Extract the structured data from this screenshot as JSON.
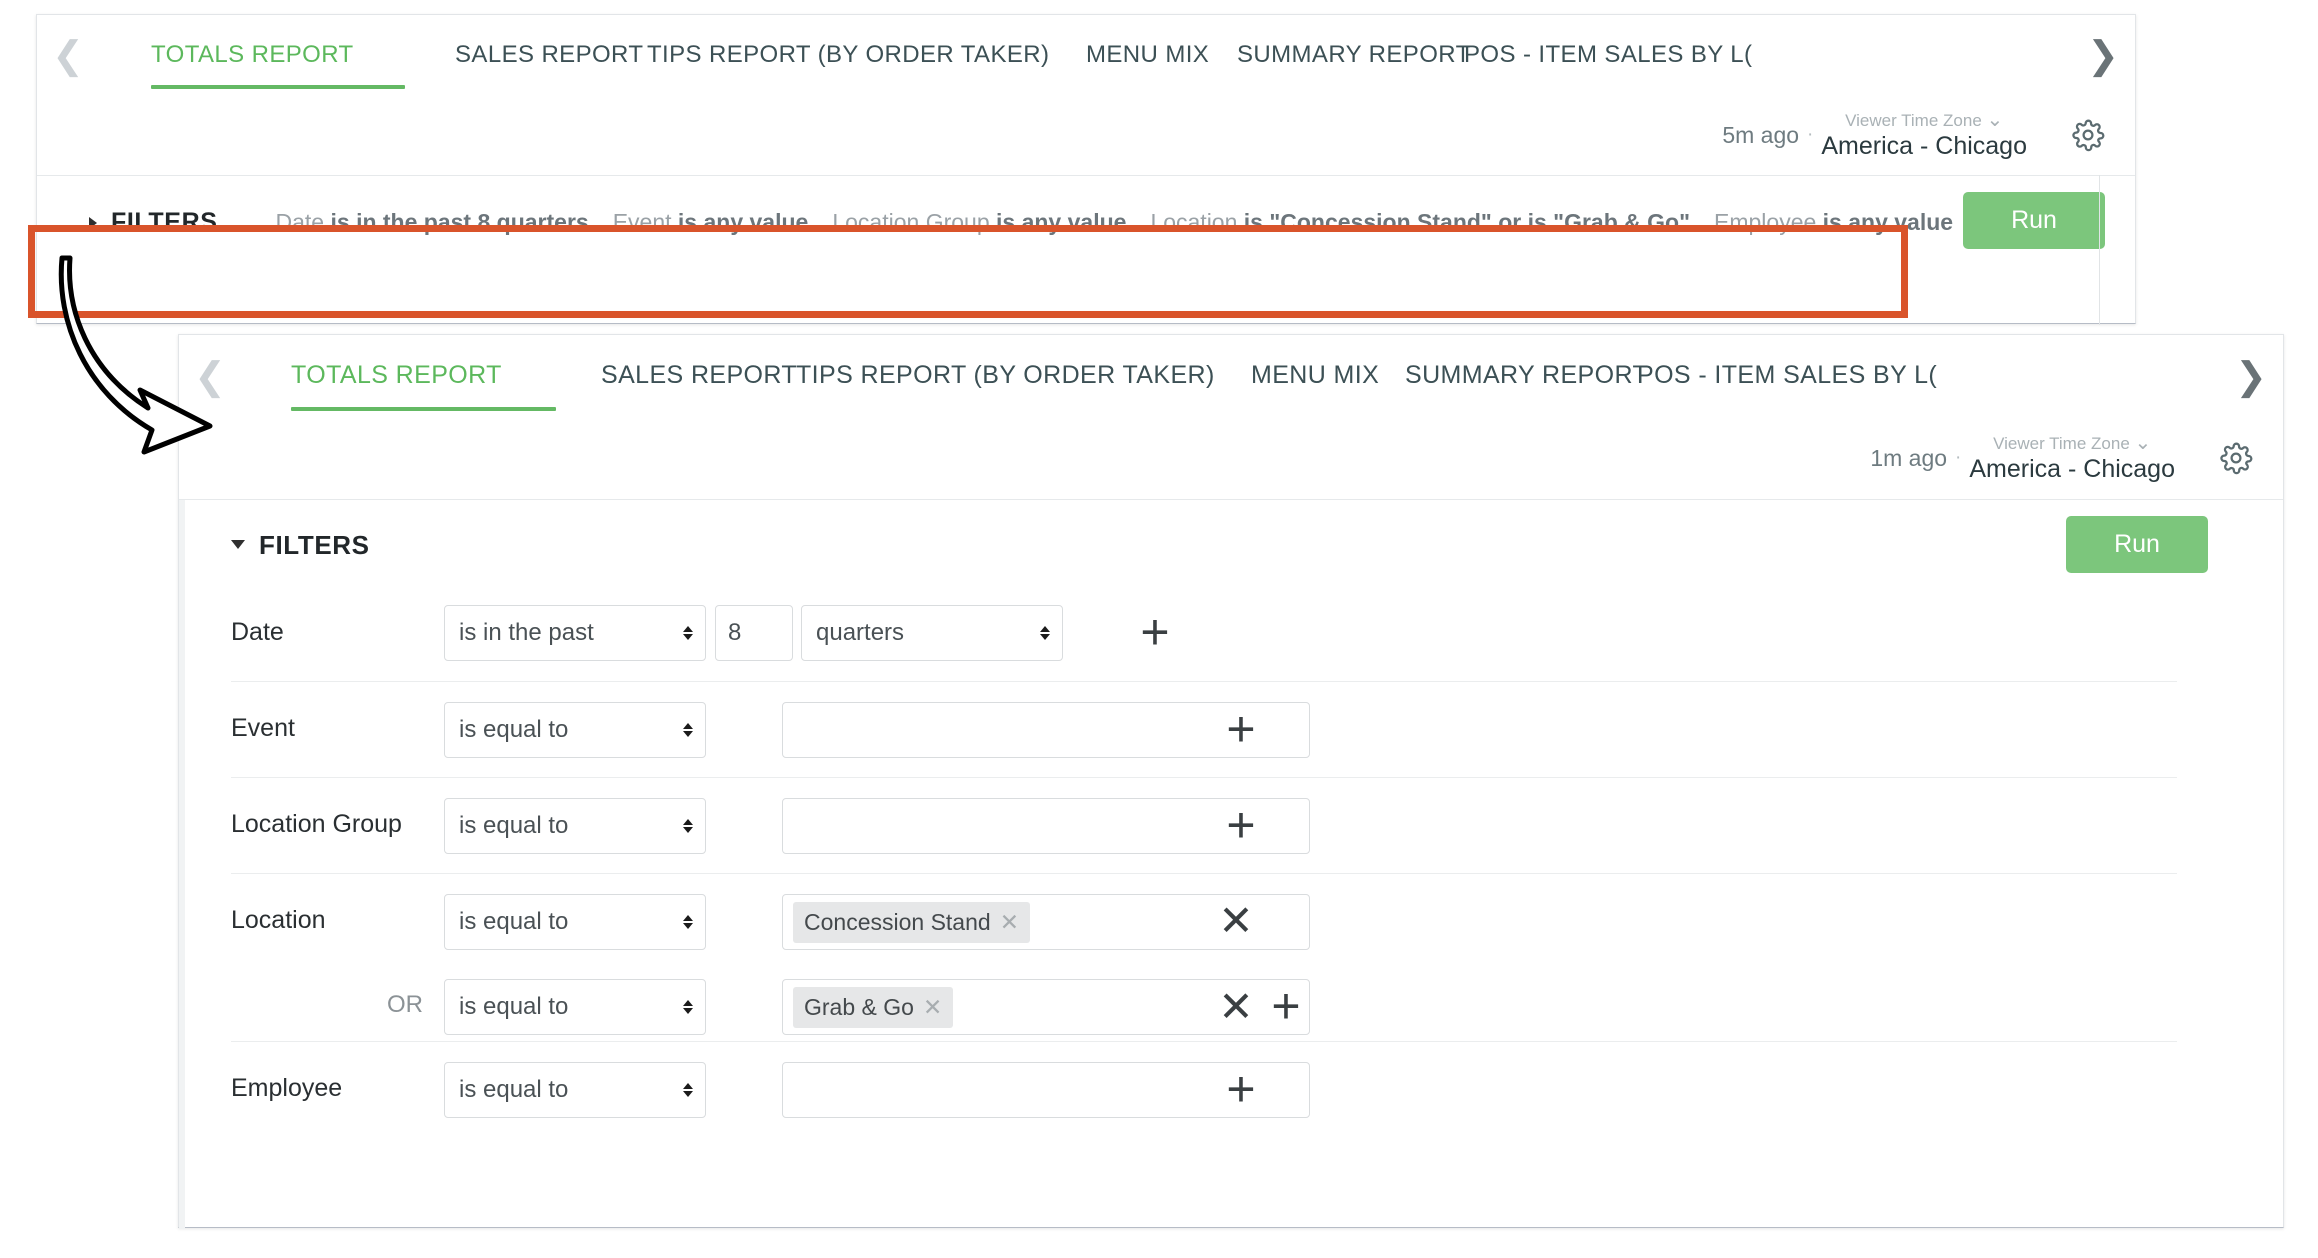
{
  "panel1": {
    "tabs": [
      {
        "label": "TOTALS REPORT",
        "active": true
      },
      {
        "label": "SALES REPORT",
        "active": false
      },
      {
        "label": "TIPS REPORT (BY ORDER TAKER)",
        "active": false
      },
      {
        "label": "MENU MIX",
        "active": false
      },
      {
        "label": "SUMMARY REPORT",
        "active": false
      },
      {
        "label": "POS - ITEM SALES BY L(",
        "active": false
      }
    ],
    "nav": {
      "prev_icon": "chevron-left-icon",
      "next_icon": "chevron-right-icon"
    },
    "meta": {
      "ago": "5m ago",
      "separator": "·",
      "timezone_label": "Viewer Time Zone",
      "timezone_value": "America - Chicago",
      "caret": "⌄",
      "gear_icon": "gear-icon"
    },
    "filters": {
      "title": "FILTERS",
      "expanded": false,
      "summary": [
        {
          "field": "Date",
          "condition": "is in the past 8 quarters"
        },
        {
          "field": "Event",
          "condition": "is any value"
        },
        {
          "field": "Location Group",
          "condition": "is any value"
        },
        {
          "field": "Location",
          "condition": "is \"Concession Stand\" or is \"Grab & Go\""
        },
        {
          "field": "Employee",
          "condition": "is any value"
        }
      ],
      "run_label": "Run"
    }
  },
  "panel2": {
    "tabs": [
      {
        "label": "TOTALS REPORT",
        "active": true
      },
      {
        "label": "SALES REPORT",
        "active": false
      },
      {
        "label": "TIPS REPORT (BY ORDER TAKER)",
        "active": false
      },
      {
        "label": "MENU MIX",
        "active": false
      },
      {
        "label": "SUMMARY REPORT",
        "active": false
      },
      {
        "label": "POS - ITEM SALES BY L(",
        "active": false
      }
    ],
    "nav": {
      "prev_icon": "chevron-left-icon",
      "next_icon": "chevron-right-icon"
    },
    "meta": {
      "ago": "1m ago",
      "separator": "·",
      "timezone_label": "Viewer Time Zone",
      "timezone_value": "America - Chicago",
      "caret": "⌄",
      "gear_icon": "gear-icon"
    },
    "filters": {
      "title": "FILTERS",
      "expanded": true,
      "run_label": "Run",
      "rows": [
        {
          "label": "Date",
          "operator": "is in the past",
          "number_value": "8",
          "unit": "quarters",
          "value": "",
          "placeholder": "",
          "chips": [],
          "add_icon": "plus-icon",
          "remove_icon": null
        },
        {
          "label": "Event",
          "operator": "is equal to",
          "value": "",
          "placeholder": "",
          "chips": [],
          "add_icon": "plus-icon",
          "remove_icon": null
        },
        {
          "label": "Location Group",
          "operator": "is equal to",
          "value": "",
          "placeholder": "",
          "chips": [],
          "add_icon": "plus-icon",
          "remove_icon": null
        },
        {
          "label": "Location",
          "operator": "is equal to",
          "value": "",
          "placeholder": "",
          "chips": [
            {
              "text": "Concession Stand",
              "remove_icon": "close-icon"
            }
          ],
          "add_icon": null,
          "remove_icon": "close-icon"
        },
        {
          "label": "",
          "conjunction": "OR",
          "operator": "is equal to",
          "value": "",
          "placeholder": "",
          "chips": [
            {
              "text": "Grab & Go",
              "remove_icon": "close-icon"
            }
          ],
          "add_icon": "plus-icon",
          "remove_icon": "close-icon"
        },
        {
          "label": "Employee",
          "operator": "is equal to",
          "value": "",
          "placeholder": "",
          "chips": [],
          "add_icon": "plus-icon",
          "remove_icon": null
        }
      ]
    }
  },
  "annotation": {
    "highlight_color": "#d9542b",
    "arrow_name": "callout-arrow",
    "highlight_target": "filters-summary-bar"
  }
}
